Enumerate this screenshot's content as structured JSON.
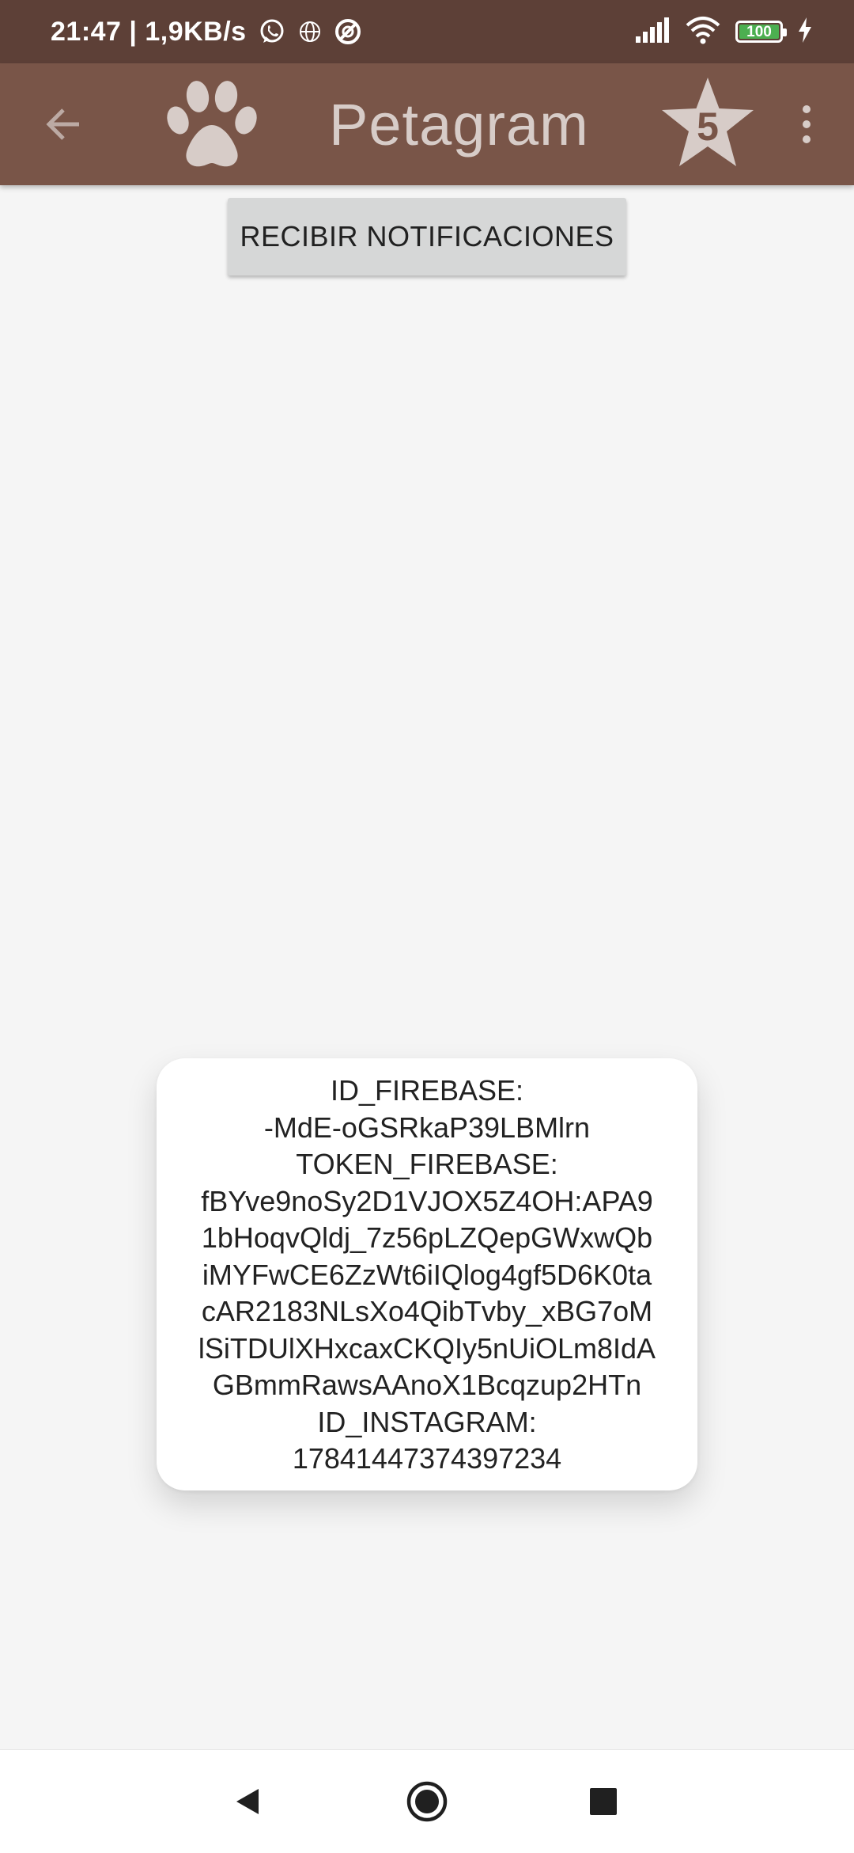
{
  "status_bar": {
    "time_speed": "21:47 | 1,9KB/s",
    "battery_level": "100",
    "icons": [
      "whatsapp-icon",
      "globe-icon",
      "no-disturb-icon",
      "signal-icon",
      "wifi-icon",
      "battery-icon",
      "charging-icon"
    ]
  },
  "app_bar": {
    "title": "Petagram",
    "star_count": "5",
    "background_color": "#795548",
    "icons": [
      "back-arrow-icon",
      "paw-icon",
      "star-icon",
      "overflow-menu-icon"
    ]
  },
  "main": {
    "button_label": "RECIBIR NOTIFICACIONES"
  },
  "toast": {
    "lines": [
      "ID_FIREBASE:",
      "-MdE-oGSRkaP39LBMlrn",
      "TOKEN_FIREBASE:",
      "fBYve9noSy2D1VJOX5Z4OH:APA9",
      "1bHoqvQldj_7z56pLZQepGWxwQb",
      "iMYFwCE6ZzWt6iIQlog4gf5D6K0ta",
      "cAR2183NLsXo4QibTvby_xBG7oM",
      "lSiTDUlXHxcaxCKQIy5nUiOLm8IdA",
      "GBmmRawsAAnoX1Bcqzup2HTn",
      "ID_INSTAGRAM:",
      "17841447374397234"
    ]
  },
  "nav_bar": {
    "icons": [
      "back-triangle-icon",
      "home-circle-icon",
      "recents-square-icon"
    ]
  }
}
